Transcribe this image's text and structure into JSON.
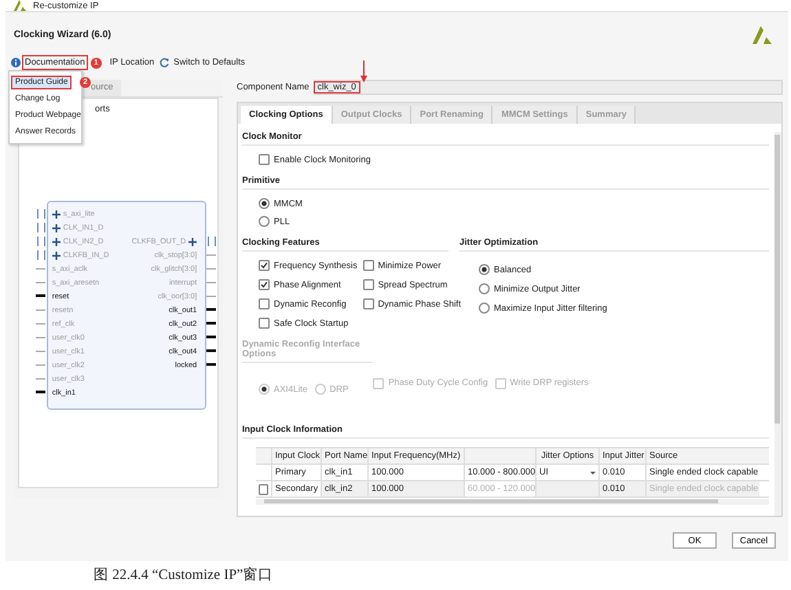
{
  "window": {
    "title": "Re-customize IP"
  },
  "header": {
    "title": "Clocking Wizard (6.0)"
  },
  "toolbar": [
    {
      "kind": "info",
      "label": "Documentation",
      "highlighted": true,
      "badge": "1"
    },
    {
      "kind": "plain",
      "label": "IP Location",
      "highlighted": false
    },
    {
      "kind": "refresh",
      "label": "Switch to Defaults",
      "highlighted": false
    }
  ],
  "doc_menu": {
    "items": [
      {
        "label": "Product Guide",
        "selected": true,
        "highlighted": true,
        "badge": "2"
      },
      {
        "label": "Change Log",
        "selected": false,
        "highlighted": false
      },
      {
        "label": "Product Webpage",
        "selected": false,
        "highlighted": false
      },
      {
        "label": "Answer Records",
        "selected": false,
        "highlighted": false
      }
    ]
  },
  "left_panel": {
    "tab_fragment": "ource",
    "option_fragment": "orts",
    "left_ports": [
      {
        "name": "s_axi_lite",
        "enabled": false,
        "bus": true
      },
      {
        "name": "CLK_IN1_D",
        "enabled": false,
        "bus": true
      },
      {
        "name": "CLK_IN2_D",
        "enabled": false,
        "bus": true
      },
      {
        "name": "CLKFB_IN_D",
        "enabled": false,
        "bus": true
      },
      {
        "name": "s_axi_aclk",
        "enabled": false,
        "bus": false
      },
      {
        "name": "s_axi_aresetn",
        "enabled": false,
        "bus": false
      },
      {
        "name": "reset",
        "enabled": true,
        "bus": false
      },
      {
        "name": "resetn",
        "enabled": false,
        "bus": false
      },
      {
        "name": "ref_clk",
        "enabled": false,
        "bus": false
      },
      {
        "name": "user_clk0",
        "enabled": false,
        "bus": false
      },
      {
        "name": "user_clk1",
        "enabled": false,
        "bus": false
      },
      {
        "name": "user_clk2",
        "enabled": false,
        "bus": false
      },
      {
        "name": "user_clk3",
        "enabled": false,
        "bus": false
      },
      {
        "name": "clk_in1",
        "enabled": true,
        "bus": false
      }
    ],
    "right_ports": [
      {
        "name": "CLKFB_OUT_D",
        "enabled": false,
        "bus": true
      },
      {
        "name": "clk_stop[3:0]",
        "enabled": false,
        "bus": false
      },
      {
        "name": "clk_glitch[3:0]",
        "enabled": false,
        "bus": false
      },
      {
        "name": "interrupt",
        "enabled": false,
        "bus": false
      },
      {
        "name": "clk_oor[3:0]",
        "enabled": false,
        "bus": false
      },
      {
        "name": "clk_out1",
        "enabled": true,
        "bus": false
      },
      {
        "name": "clk_out2",
        "enabled": true,
        "bus": false
      },
      {
        "name": "clk_out3",
        "enabled": true,
        "bus": false
      },
      {
        "name": "clk_out4",
        "enabled": true,
        "bus": false
      },
      {
        "name": "locked",
        "enabled": true,
        "bus": false
      }
    ]
  },
  "component_name": {
    "label": "Component Name",
    "value": "clk_wiz_0",
    "highlighted": true
  },
  "tabs": [
    {
      "label": "Clocking Options",
      "selected": true
    },
    {
      "label": "Output Clocks",
      "selected": false
    },
    {
      "label": "Port Renaming",
      "selected": false
    },
    {
      "label": "MMCM Settings",
      "selected": false
    },
    {
      "label": "Summary",
      "selected": false
    }
  ],
  "clock_monitor": {
    "title": "Clock Monitor",
    "options": [
      {
        "label": "Enable Clock Monitoring",
        "checked": false
      }
    ]
  },
  "primitive": {
    "title": "Primitive",
    "options": [
      {
        "label": "MMCM",
        "selected": true
      },
      {
        "label": "PLL",
        "selected": false
      }
    ]
  },
  "clocking_features": {
    "title": "Clocking Features",
    "options": [
      {
        "label": "Frequency Synthesis",
        "checked": true
      },
      {
        "label": "Minimize Power",
        "checked": false
      },
      {
        "label": "Phase Alignment",
        "checked": true
      },
      {
        "label": "Spread Spectrum",
        "checked": false
      },
      {
        "label": "Dynamic Reconfig",
        "checked": false
      },
      {
        "label": "Dynamic Phase Shift",
        "checked": false
      },
      {
        "label": "Safe Clock Startup",
        "checked": false
      }
    ]
  },
  "jitter_optimization": {
    "title": "Jitter Optimization",
    "options": [
      {
        "label": "Balanced",
        "selected": true
      },
      {
        "label": "Minimize Output Jitter",
        "selected": false
      },
      {
        "label": "Maximize Input Jitter filtering",
        "selected": false
      }
    ]
  },
  "dynamic_reconfig_interface": {
    "title": "Dynamic Reconfig Interface Options",
    "enabled": false,
    "interfaces": [
      {
        "label": "AXI4Lite",
        "selected": true
      },
      {
        "label": "DRP",
        "selected": false
      }
    ],
    "options": [
      {
        "label": "Phase Duty Cycle Config",
        "checked": false
      },
      {
        "label": "Write DRP registers",
        "checked": false
      }
    ]
  },
  "input_clock_table": {
    "title": "Input Clock Information",
    "headers": {
      "input_clock": "Input Clock",
      "port_name": "Port Name",
      "input_frequency": "Input Frequency(MHz)",
      "jitter_options": "Jitter Options",
      "input_jitter": "Input Jitter",
      "source": "Source"
    },
    "rows": [
      {
        "input_clock": "Primary",
        "enabled": true,
        "port_name": "clk_in1",
        "input_frequency": "100.000",
        "range": "10.000 - 800.000",
        "jitter_option": "UI",
        "input_jitter": "0.010",
        "source": "Single ended clock capable"
      },
      {
        "input_clock": "Secondary",
        "enabled": false,
        "checked": false,
        "port_name": "clk_in2",
        "input_frequency": "100.000",
        "range": "60.000 - 120.000",
        "input_jitter": "0.010",
        "source": "Single ended clock capable"
      }
    ]
  },
  "buttons": [
    {
      "label": "OK"
    },
    {
      "label": "Cancel"
    }
  ],
  "caption": "图 22.4.4 “Customize IP”窗口"
}
